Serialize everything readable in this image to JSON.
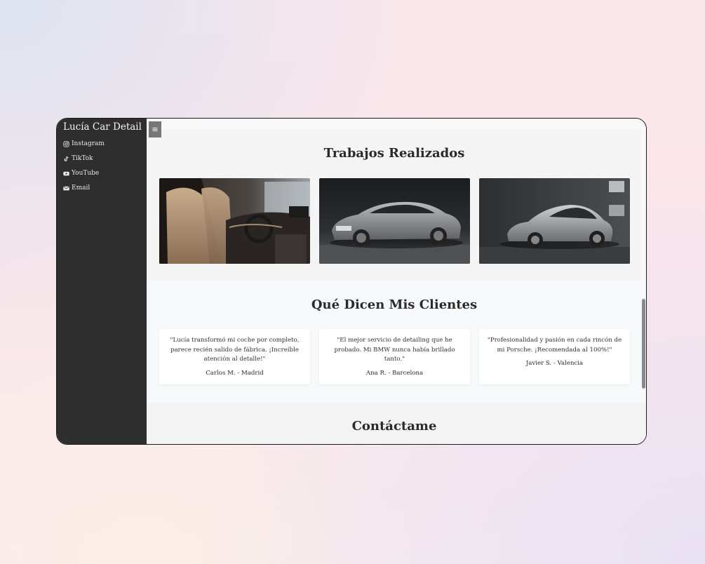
{
  "sidebar": {
    "brand": "Lucía Car Detail",
    "links": [
      {
        "label": "Instagram",
        "icon": "instagram-icon"
      },
      {
        "label": "TikTok",
        "icon": "tiktok-icon"
      },
      {
        "label": "YouTube",
        "icon": "youtube-icon"
      },
      {
        "label": "Email",
        "icon": "envelope-icon"
      }
    ]
  },
  "menu_button": {
    "label": "≡"
  },
  "sections": {
    "trabajos": {
      "title": "Trabajos Realizados"
    },
    "clientes": {
      "title": "Qué Dicen Mis Clientes",
      "testimonials": [
        {
          "quote": "\"Lucía transformó mi coche por completo, parece recién salido de fábrica. ¡Increíble atención al detalle!\"",
          "author": "Carlos M. - Madrid"
        },
        {
          "quote": "\"El mejor servicio de detailing que he probado. Mi BMW nunca había brillado tanto.\"",
          "author": "Ana R. - Barcelona"
        },
        {
          "quote": "\"Profesionalidad y pasión en cada rincón de mi Porsche. ¡Recomendada al 100%!\"",
          "author": "Javier S. - Valencia"
        }
      ]
    },
    "contacto": {
      "title": "Contáctame"
    }
  },
  "colors": {
    "sidebar_bg": "#2e2e2e",
    "menu_button_bg": "#777777",
    "title_text": "#2a2a2a"
  }
}
